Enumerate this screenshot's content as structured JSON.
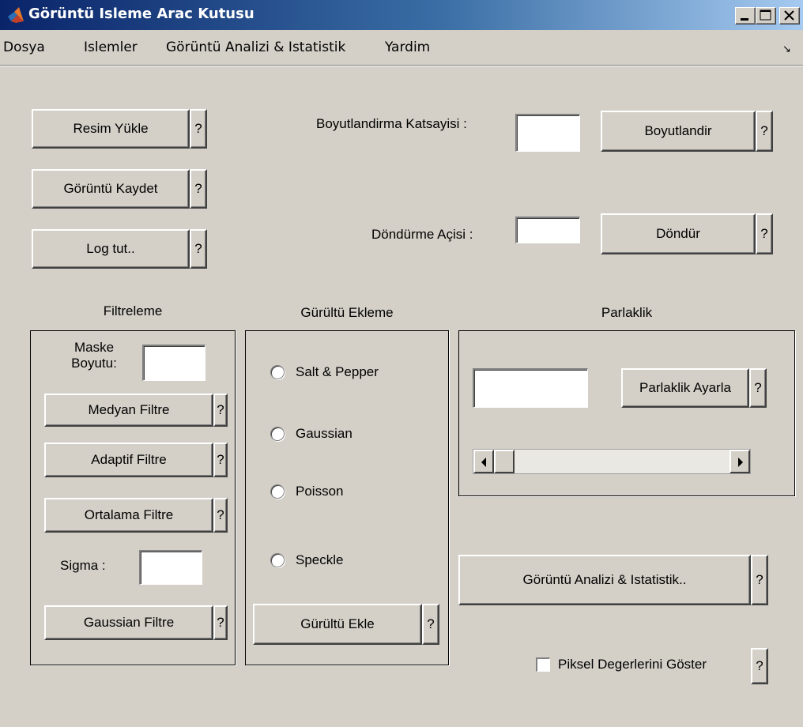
{
  "window": {
    "title": "Görüntü Isleme Arac Kutusu"
  },
  "menu": {
    "items": [
      "Dosya",
      "Islemler",
      "Görüntü Analizi & Istatistik",
      "Yardim"
    ],
    "dock_icon": "↘"
  },
  "help_label": "?",
  "file_buttons": {
    "load": "Resim Yükle",
    "save": "Görüntü Kaydet",
    "log": "Log tut.."
  },
  "resize": {
    "label": "Boyutlandirma Katsayisi :",
    "value": "",
    "button": "Boyutlandir"
  },
  "rotate": {
    "label": "Döndürme Açisi :",
    "value": "",
    "button": "Döndür"
  },
  "filter_panel": {
    "title": "Filtreleme",
    "mask_label_line1": "Maske",
    "mask_label_line2": "Boyutu:",
    "mask_value": "",
    "median": "Medyan Filtre",
    "adaptive": "Adaptif Filtre",
    "mean": "Ortalama Filtre",
    "sigma_label": "Sigma :",
    "sigma_value": "",
    "gaussian": "Gaussian Filtre"
  },
  "noise_panel": {
    "title": "Gürültü Ekleme",
    "options": [
      "Salt & Pepper",
      "Gaussian",
      "Poisson",
      "Speckle"
    ],
    "button": "Gürültü Ekle"
  },
  "brightness_panel": {
    "title": "Parlaklik",
    "value": "",
    "button": "Parlaklik Ayarla",
    "slider_value": 0
  },
  "analysis_button": "Görüntü Analizi & Istatistik..",
  "pixel_checkbox": {
    "label": "Piksel Degerlerini Göster",
    "checked": false
  },
  "colors": {
    "face": "#d4d0c8",
    "title_start": "#0a246a",
    "title_end": "#a6caf0"
  }
}
